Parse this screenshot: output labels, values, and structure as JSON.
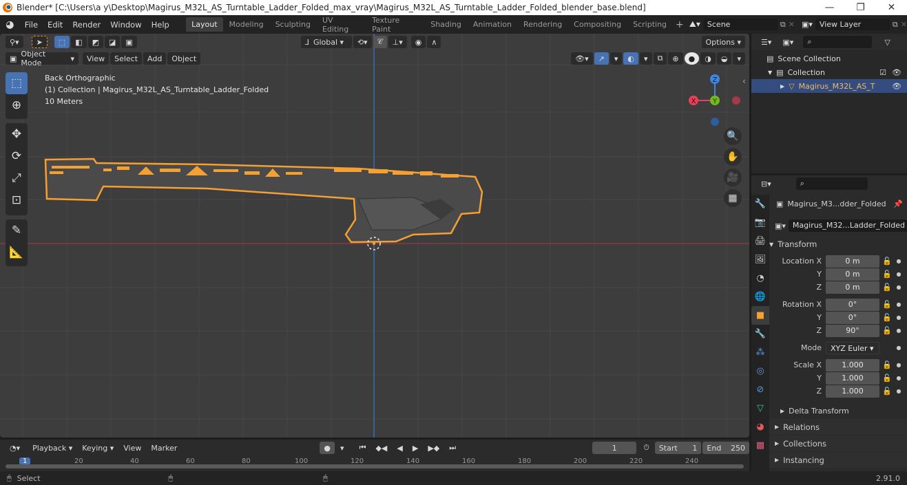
{
  "window": {
    "title": "Blender* [C:\\Users\\a y\\Desktop\\Magirus_M32L_AS_Turntable_Ladder_Folded_max_vray\\Magirus_M32L_AS_Turntable_Ladder_Folded_blender_base.blend]",
    "controls": [
      "—",
      "❐",
      "✕"
    ]
  },
  "menu": [
    "File",
    "Edit",
    "Render",
    "Window",
    "Help"
  ],
  "workspaces": [
    {
      "label": "Layout",
      "active": true
    },
    {
      "label": "Modeling"
    },
    {
      "label": "Sculpting"
    },
    {
      "label": "UV Editing"
    },
    {
      "label": "Texture Paint"
    },
    {
      "label": "Shading"
    },
    {
      "label": "Animation"
    },
    {
      "label": "Rendering"
    },
    {
      "label": "Compositing"
    },
    {
      "label": "Scripting"
    }
  ],
  "scene": {
    "name": "Scene",
    "view_layer": "View Layer"
  },
  "tool_header": {
    "orientation": "Global",
    "options": "Options"
  },
  "viewport_header": {
    "mode": "Object Mode",
    "menus": [
      "View",
      "Select",
      "Add",
      "Object"
    ]
  },
  "viewport": {
    "view_name": "Back Orthographic",
    "collection_info": "(1) Collection | Magirus_M32L_AS_Turntable_Ladder_Folded",
    "scale": "10 Meters",
    "gizmo": {
      "x": "X",
      "y": "Y",
      "z": "Z"
    },
    "colors": {
      "x": "#e8405a",
      "y": "#74b91c",
      "z": "#3e86e0",
      "selection": "#f5a033"
    }
  },
  "outliner": {
    "search_placeholder": "",
    "scene_collection": "Scene Collection",
    "collection": "Collection",
    "object": "Magirus_M32L_AS_T"
  },
  "properties": {
    "object_name": "Magirus_M3...dder_Folded",
    "data_name": "Magirus_M32...Ladder_Folded",
    "transform_label": "Transform",
    "location": {
      "label": "Location X",
      "x": "0 m",
      "y": "0 m",
      "z": "0 m"
    },
    "rotation": {
      "label": "Rotation X",
      "x": "0°",
      "y": "0°",
      "z": "90°"
    },
    "mode_label": "Mode",
    "mode_value": "XYZ Euler",
    "scale": {
      "label": "Scale X",
      "x": "1.000",
      "y": "1.000",
      "z": "1.000"
    },
    "axis_y": "Y",
    "axis_z": "Z",
    "delta_transform": "Delta Transform",
    "panels": [
      "Relations",
      "Collections",
      "Instancing"
    ]
  },
  "timeline": {
    "menus": [
      "Playback",
      "Keying",
      "View",
      "Marker"
    ],
    "current_frame": "1",
    "start_label": "Start",
    "start": "1",
    "end_label": "End",
    "end": "250",
    "ruler_current": "1",
    "ticks": [
      "20",
      "40",
      "60",
      "80",
      "100",
      "120",
      "140",
      "160",
      "180",
      "200",
      "220",
      "240"
    ]
  },
  "statusbar": {
    "select": "Select",
    "version": "2.91.0"
  }
}
